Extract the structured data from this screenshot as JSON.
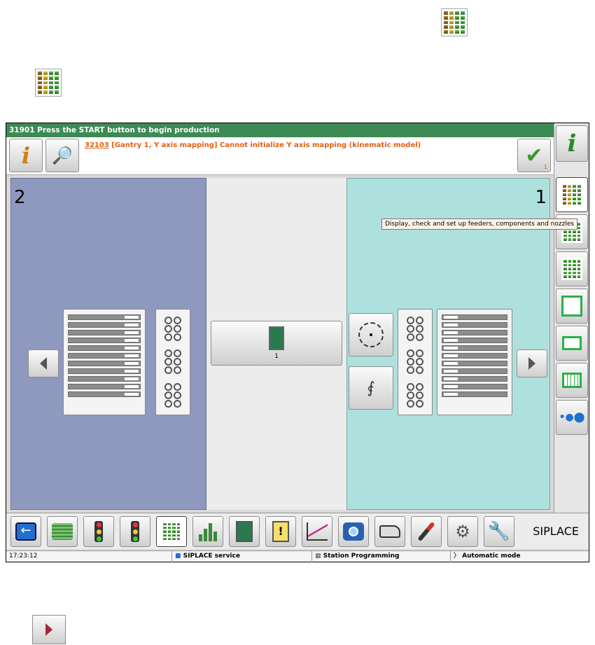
{
  "doc_icons": [
    "multi-grid-icon",
    "feeder-grid-icon",
    "next-arrow-icon"
  ],
  "message_bar": {
    "text": "31901 Press the START button to begin production"
  },
  "message": {
    "code": "32103",
    "text": " [Gantry 1, Y axis mapping] Cannot initialize Y axis mapping (kinematic model)",
    "ack_count": "1"
  },
  "panels": {
    "left": {
      "number": "2"
    },
    "right": {
      "number": "1"
    }
  },
  "center_button": {
    "label": "1"
  },
  "tooltip": "Display, check and set up feeders, components and nozzles",
  "bottom_bar": {
    "brand": "SIPLACE"
  },
  "status_bar": {
    "time": "17:23:12",
    "service": "SIPLACE service",
    "station": "Station Programming",
    "mode": "Automatic mode"
  },
  "colors": {
    "message_bar": "#3e8a54",
    "panel_left": "#8f98be",
    "panel_right": "#aee0dd",
    "message_text": "#e06010"
  }
}
